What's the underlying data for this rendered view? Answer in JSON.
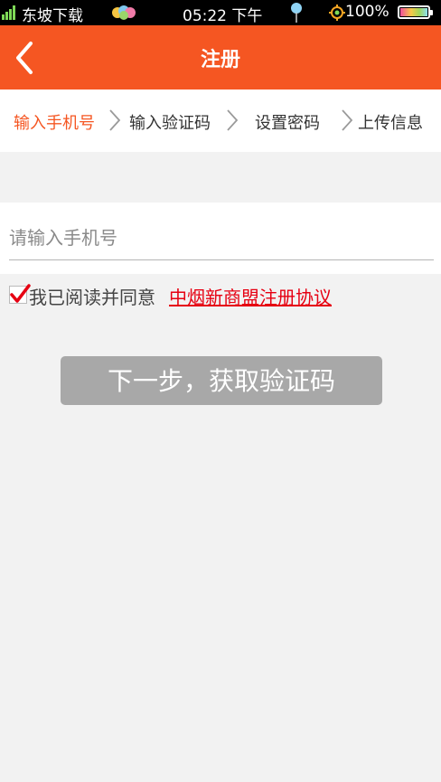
{
  "status_bar": {
    "carrier": "东坡下载",
    "time": "05:22 下午",
    "battery_percent": "100%",
    "battery_level": 1.0,
    "icons": [
      "signal-icon",
      "balloons-icon",
      "location-pin-icon",
      "gps-icon",
      "battery-icon"
    ]
  },
  "header": {
    "title": "注册",
    "back_icon": "chevron-left-icon"
  },
  "steps": [
    {
      "label": "输入手机号",
      "active": true
    },
    {
      "label": "输入验证码",
      "active": false
    },
    {
      "label": "设置密码",
      "active": false
    },
    {
      "label": "上传信息",
      "active": false
    }
  ],
  "form": {
    "phone_placeholder": "请输入手机号",
    "phone_value": "",
    "agree_checked": true,
    "agree_text": "我已阅读并同意",
    "agree_link": "中烟新商盟注册协议",
    "next_button": "下一步，获取验证码"
  },
  "colors": {
    "brand": "#f55622",
    "link": "#e60012",
    "button_disabled": "#a8a8a8",
    "background": "#f2f2f2"
  }
}
